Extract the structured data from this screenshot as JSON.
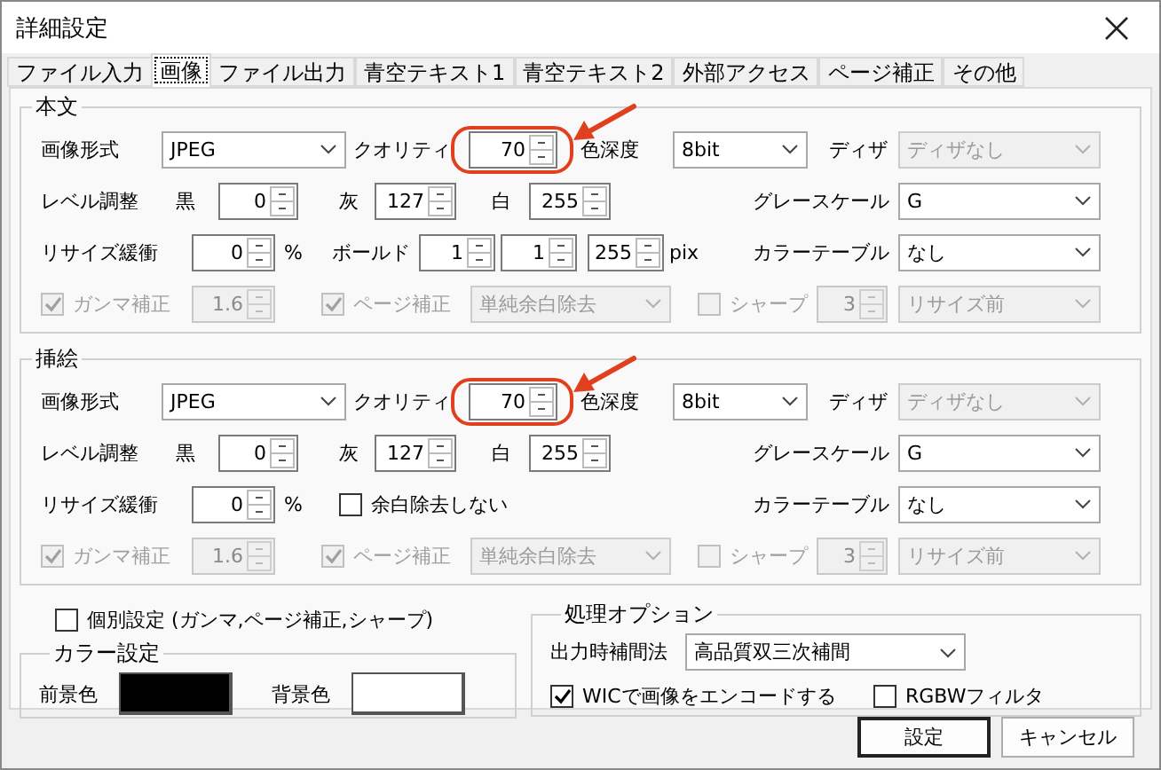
{
  "window": {
    "title": "詳細設定"
  },
  "tabs": [
    {
      "label": "ファイル入力",
      "selected": false
    },
    {
      "label": "画像",
      "selected": true
    },
    {
      "label": "ファイル出力",
      "selected": false
    },
    {
      "label": "青空テキスト1",
      "selected": false
    },
    {
      "label": "青空テキスト2",
      "selected": false
    },
    {
      "label": "外部アクセス",
      "selected": false
    },
    {
      "label": "ページ補正",
      "selected": false
    },
    {
      "label": "その他",
      "selected": false
    }
  ],
  "sections": [
    {
      "title": "本文",
      "rows": [
        {
          "items": [
            {
              "kind": "label",
              "text": "画像形式"
            },
            {
              "kind": "select",
              "value": "JPEG",
              "disabled": false
            },
            {
              "kind": "label",
              "text": "クオリティ"
            },
            {
              "kind": "spin",
              "value": "70",
              "disabled": false,
              "highlighted": true
            },
            {
              "kind": "label",
              "text": "色深度"
            },
            {
              "kind": "select",
              "value": "8bit",
              "disabled": false
            }
          ],
          "end": {
            "label": "ディザ",
            "value": "ディザなし",
            "disabled": true
          }
        },
        {
          "items": [
            {
              "kind": "label",
              "text": "レベル調整"
            },
            {
              "kind": "label",
              "text": "黒"
            },
            {
              "kind": "spin",
              "value": "0",
              "disabled": false,
              "highlighted": false
            },
            {
              "kind": "label",
              "text": "灰"
            },
            {
              "kind": "spin",
              "value": "127",
              "disabled": false,
              "highlighted": false
            },
            {
              "kind": "label",
              "text": "白"
            },
            {
              "kind": "spin",
              "value": "255",
              "disabled": false,
              "highlighted": false
            }
          ],
          "end": {
            "label": "グレースケール",
            "value": "G",
            "disabled": false
          }
        },
        {
          "items": [
            {
              "kind": "label",
              "text": "リサイズ緩衝"
            },
            {
              "kind": "spin",
              "value": "0",
              "disabled": false,
              "highlighted": false
            },
            {
              "kind": "label",
              "text": "%"
            },
            {
              "kind": "label",
              "text": "ボールド"
            },
            {
              "kind": "spin",
              "value": "1",
              "disabled": false,
              "highlighted": false
            },
            {
              "kind": "spin",
              "value": "1",
              "disabled": false,
              "highlighted": false
            },
            {
              "kind": "spin",
              "value": "255",
              "disabled": false,
              "highlighted": false
            },
            {
              "kind": "label",
              "text": "pix"
            }
          ],
          "end": {
            "label": "カラーテーブル",
            "value": "なし",
            "disabled": false
          }
        },
        {
          "items": [
            {
              "kind": "checkbox",
              "label": "ガンマ補正",
              "checked": true,
              "disabled": true
            },
            {
              "kind": "spin",
              "value": "1.6",
              "disabled": true,
              "highlighted": false
            },
            {
              "kind": "checkbox",
              "label": "ページ補正",
              "checked": true,
              "disabled": true
            },
            {
              "kind": "select",
              "value": "単純余白除去",
              "disabled": true
            },
            {
              "kind": "checkbox",
              "label": "シャープ",
              "checked": false,
              "disabled": true
            },
            {
              "kind": "spin",
              "value": "3",
              "disabled": true,
              "highlighted": false
            }
          ],
          "end": {
            "value": "リサイズ前",
            "disabled": true
          }
        }
      ]
    },
    {
      "title": "挿絵",
      "rows": [
        {
          "items": [
            {
              "kind": "label",
              "text": "画像形式"
            },
            {
              "kind": "select",
              "value": "JPEG",
              "disabled": false
            },
            {
              "kind": "label",
              "text": "クオリティ"
            },
            {
              "kind": "spin",
              "value": "70",
              "disabled": false,
              "highlighted": true
            },
            {
              "kind": "label",
              "text": "色深度"
            },
            {
              "kind": "select",
              "value": "8bit",
              "disabled": false
            }
          ],
          "end": {
            "label": "ディザ",
            "value": "ディザなし",
            "disabled": true
          }
        },
        {
          "items": [
            {
              "kind": "label",
              "text": "レベル調整"
            },
            {
              "kind": "label",
              "text": "黒"
            },
            {
              "kind": "spin",
              "value": "0",
              "disabled": false,
              "highlighted": false
            },
            {
              "kind": "label",
              "text": "灰"
            },
            {
              "kind": "spin",
              "value": "127",
              "disabled": false,
              "highlighted": false
            },
            {
              "kind": "label",
              "text": "白"
            },
            {
              "kind": "spin",
              "value": "255",
              "disabled": false,
              "highlighted": false
            }
          ],
          "end": {
            "label": "グレースケール",
            "value": "G",
            "disabled": false
          }
        },
        {
          "items": [
            {
              "kind": "label",
              "text": "リサイズ緩衝"
            },
            {
              "kind": "spin",
              "value": "0",
              "disabled": false,
              "highlighted": false
            },
            {
              "kind": "label",
              "text": "%"
            },
            {
              "kind": "checkbox",
              "label": "余白除去しない",
              "checked": false,
              "disabled": false
            }
          ],
          "end": {
            "label": "カラーテーブル",
            "value": "なし",
            "disabled": false
          }
        },
        {
          "items": [
            {
              "kind": "checkbox",
              "label": "ガンマ補正",
              "checked": true,
              "disabled": true
            },
            {
              "kind": "spin",
              "value": "1.6",
              "disabled": true,
              "highlighted": false
            },
            {
              "kind": "checkbox",
              "label": "ページ補正",
              "checked": true,
              "disabled": true
            },
            {
              "kind": "select",
              "value": "単純余白除去",
              "disabled": true
            },
            {
              "kind": "checkbox",
              "label": "シャープ",
              "checked": false,
              "disabled": true
            },
            {
              "kind": "spin",
              "value": "3",
              "disabled": true,
              "highlighted": false
            }
          ],
          "end": {
            "value": "リサイズ前",
            "disabled": true
          }
        }
      ]
    }
  ],
  "individual": {
    "label": "個別設定 (ガンマ,ページ補正,シャープ)",
    "checked": false
  },
  "color_settings": {
    "title": "カラー設定",
    "items": [
      {
        "label": "前景色",
        "color": "#000000"
      },
      {
        "label": "背景色",
        "color": "#ffffff"
      }
    ]
  },
  "processing": {
    "title": "処理オプション",
    "interp_label": "出力時補間法",
    "interp_value": "高品質双三次補間",
    "checkboxes": [
      {
        "label": "WICで画像をエンコードする",
        "checked": true
      },
      {
        "label": "RGBWフィルタ",
        "checked": false
      }
    ]
  },
  "buttons": [
    {
      "label": "設定",
      "default": true
    },
    {
      "label": "キャンセル",
      "default": false
    }
  ]
}
